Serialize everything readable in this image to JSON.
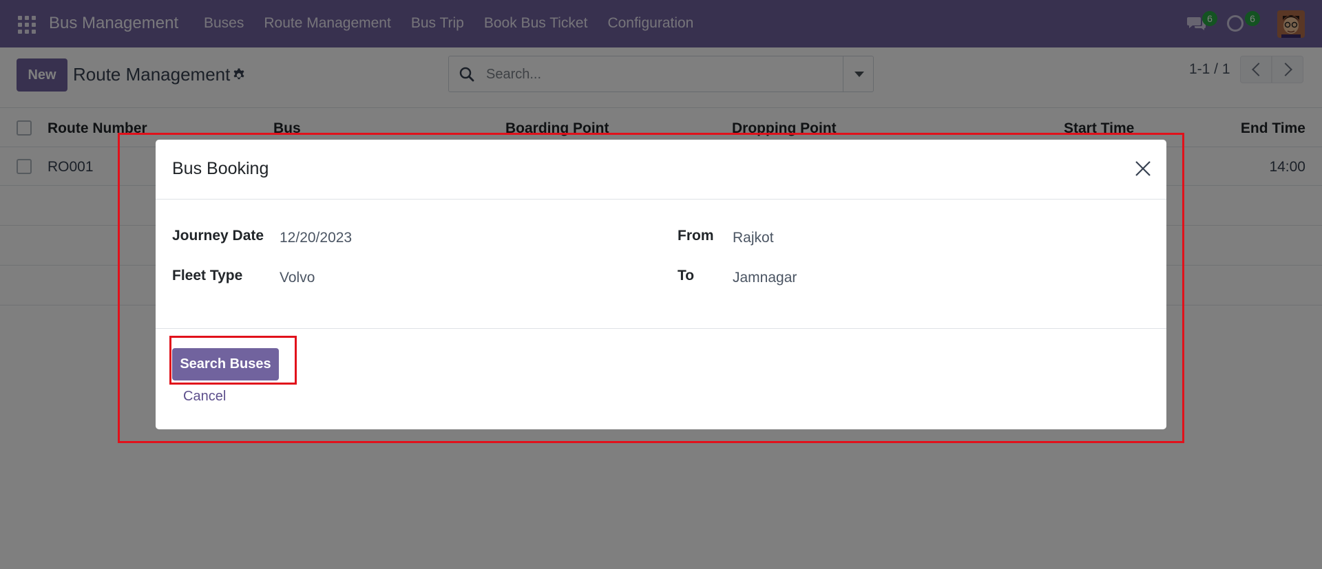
{
  "navbar": {
    "app_name": "Bus Management",
    "menu_items": [
      "Buses",
      "Route Management",
      "Bus Trip",
      "Book Bus Ticket",
      "Configuration"
    ],
    "messages_count": "6",
    "activities_count": "6"
  },
  "control_panel": {
    "new_label": "New",
    "title": "Route Management",
    "search_placeholder": "Search...",
    "pager": "1-1 / 1"
  },
  "list": {
    "columns": [
      "Route Number",
      "Bus",
      "Boarding Point",
      "Dropping Point",
      "Start Time",
      "End Time"
    ],
    "rows": [
      {
        "route_number": "RO001",
        "end_time": "14:00"
      }
    ]
  },
  "modal": {
    "title": "Bus Booking",
    "fields": {
      "journey_date_label": "Journey Date",
      "journey_date_value": "12/20/2023",
      "fleet_type_label": "Fleet Type",
      "fleet_type_value": "Volvo",
      "from_label": "From",
      "from_value": "Rajkot",
      "to_label": "To",
      "to_value": "Jamnagar"
    },
    "search_button": "Search Buses",
    "cancel_button": "Cancel"
  },
  "colors": {
    "brand": "#71639e",
    "highlight": "#e1111b",
    "badge": "#28a745"
  }
}
